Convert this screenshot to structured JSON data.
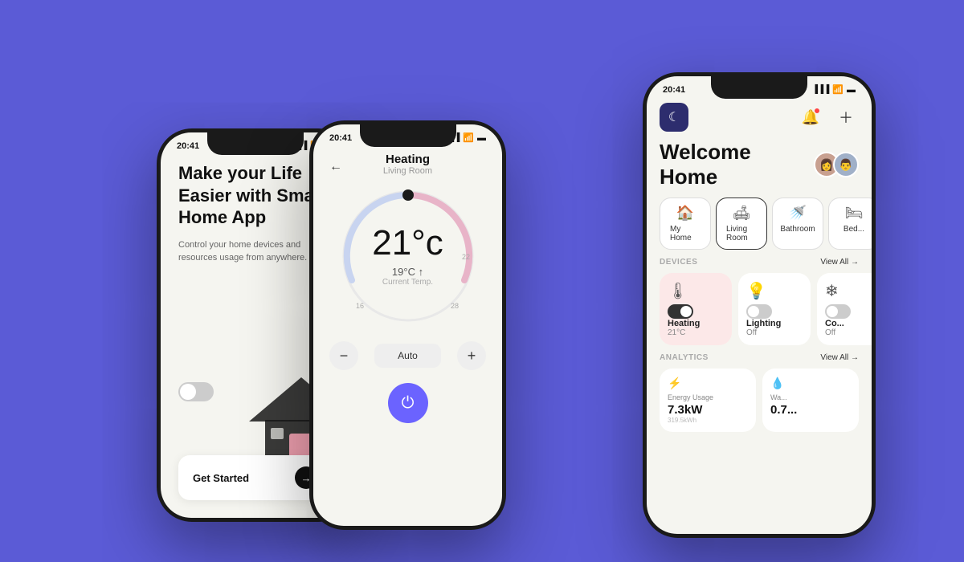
{
  "background": "#5B5BD6",
  "phone1": {
    "status_time": "20:41",
    "title": "Make your Life Easier with Smart Home App",
    "description": "Control your home devices and resources usage from anywhere.",
    "cta_label": "Get Started"
  },
  "phone2": {
    "status_time": "20:41",
    "screen_title": "Heating",
    "screen_subtitle": "Living Room",
    "temperature": "21°c",
    "current_temp": "19°C ↑",
    "current_temp_label": "Current Temp.",
    "mode": "Auto"
  },
  "phone3": {
    "status_time": "20:41",
    "welcome": "Welcome Home",
    "rooms": [
      {
        "label": "My Home",
        "icon": "🏠",
        "active": false
      },
      {
        "label": "Living Room",
        "icon": "🛋",
        "active": true
      },
      {
        "label": "Bathroom",
        "icon": "🚿",
        "active": false
      },
      {
        "label": "Bed...",
        "icon": "🛏",
        "active": false
      }
    ],
    "devices_section_label": "DEVICES",
    "devices_view_all": "View All →",
    "devices": [
      {
        "name": "Heating",
        "value": "21°C",
        "icon": "🌡",
        "active": true,
        "toggle": "on"
      },
      {
        "name": "Lighting",
        "value": "Off",
        "icon": "💡",
        "active": false,
        "toggle": "off"
      },
      {
        "name": "Co...",
        "value": "Off",
        "icon": "❄",
        "active": false,
        "toggle": "off"
      }
    ],
    "analytics_section_label": "ANALYTICS",
    "analytics_view_all": "View All →",
    "analytics": [
      {
        "icon": "⚡",
        "label": "Energy Usage",
        "value": "7.3kW",
        "sub": "319.5kWh"
      },
      {
        "icon": "💧",
        "label": "Wa...",
        "value": "0.7...",
        "sub": ""
      }
    ]
  }
}
